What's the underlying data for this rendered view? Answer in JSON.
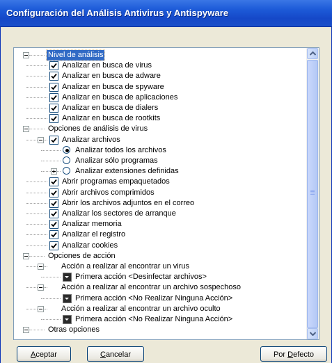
{
  "window": {
    "title": "Configuración del Análisis Antivirus y Antispyware"
  },
  "tree": {
    "rows": [
      {
        "label": "Nivel de análisis",
        "level": 0,
        "expander": "minus",
        "control": "none",
        "selected": true
      },
      {
        "label": "Analizar en busca de virus",
        "level": 1,
        "control": "checkbox",
        "checked": true
      },
      {
        "label": "Analizar en busca de adware",
        "level": 1,
        "control": "checkbox",
        "checked": true
      },
      {
        "label": "Analizar en busca de spyware",
        "level": 1,
        "control": "checkbox",
        "checked": true
      },
      {
        "label": "Analizar en busca de aplicaciones",
        "level": 1,
        "control": "checkbox",
        "checked": true
      },
      {
        "label": "Analizar en busca de dialers",
        "level": 1,
        "control": "checkbox",
        "checked": true
      },
      {
        "label": "Analizar en busca de rootkits",
        "level": 1,
        "control": "checkbox",
        "checked": true
      },
      {
        "label": "Opciones de análisis de virus",
        "level": 0,
        "expander": "minus",
        "control": "none"
      },
      {
        "label": "Analizar archivos",
        "level": 1,
        "expander": "minus",
        "control": "checkbox",
        "checked": true
      },
      {
        "label": "Analizar todos los archivos",
        "level": 2,
        "control": "radio",
        "checked": true
      },
      {
        "label": "Analizar sólo programas",
        "level": 2,
        "control": "radio",
        "checked": false
      },
      {
        "label": "Analizar extensiones definidas",
        "level": 2,
        "expander": "plus",
        "control": "radio",
        "checked": false
      },
      {
        "label": "Abrir programas empaquetados",
        "level": 1,
        "control": "checkbox",
        "checked": true
      },
      {
        "label": "Abrir archivos comprimidos",
        "level": 1,
        "control": "checkbox",
        "checked": true
      },
      {
        "label": "Abrir los archivos adjuntos en el correo",
        "level": 1,
        "control": "checkbox",
        "checked": true
      },
      {
        "label": "Analizar los sectores de arranque",
        "level": 1,
        "control": "checkbox",
        "checked": true
      },
      {
        "label": "Analizar memoria",
        "level": 1,
        "control": "checkbox",
        "checked": true
      },
      {
        "label": "Analizar el registro",
        "level": 1,
        "control": "checkbox",
        "checked": true
      },
      {
        "label": "Analizar cookies",
        "level": 1,
        "control": "checkbox",
        "checked": true
      },
      {
        "label": "Opciones de acción",
        "level": 0,
        "expander": "minus",
        "control": "none"
      },
      {
        "label": "Acción a realizar al encontrar un virus",
        "level": 1,
        "expander": "minus",
        "control": "none"
      },
      {
        "label": "Primera acción <Desinfectar archivos>",
        "level": 2,
        "control": "action"
      },
      {
        "label": "Acción a realizar al encontrar un archivo sospechoso",
        "level": 1,
        "expander": "minus",
        "control": "none"
      },
      {
        "label": "Primera acción <No Realizar Ninguna Acción>",
        "level": 2,
        "control": "action"
      },
      {
        "label": "Acción a realizar al encontrar un archivo oculto",
        "level": 1,
        "expander": "minus",
        "control": "none"
      },
      {
        "label": "Primera acción <No Realizar Ninguna Acción>",
        "level": 2,
        "control": "action"
      },
      {
        "label": "Otras opciones",
        "level": 0,
        "expander": "minus",
        "control": "none"
      }
    ]
  },
  "buttons": {
    "accept": {
      "mnemonic": "A",
      "rest": "ceptar"
    },
    "cancel": {
      "mnemonic": "C",
      "rest": "ancelar"
    },
    "defaults": {
      "before": "Por ",
      "mnemonic": "D",
      "rest": "efecto"
    }
  },
  "colors": {
    "selection": "#316ac5",
    "titlebar": "#1d5bd8",
    "dialog": "#ece9d8"
  }
}
